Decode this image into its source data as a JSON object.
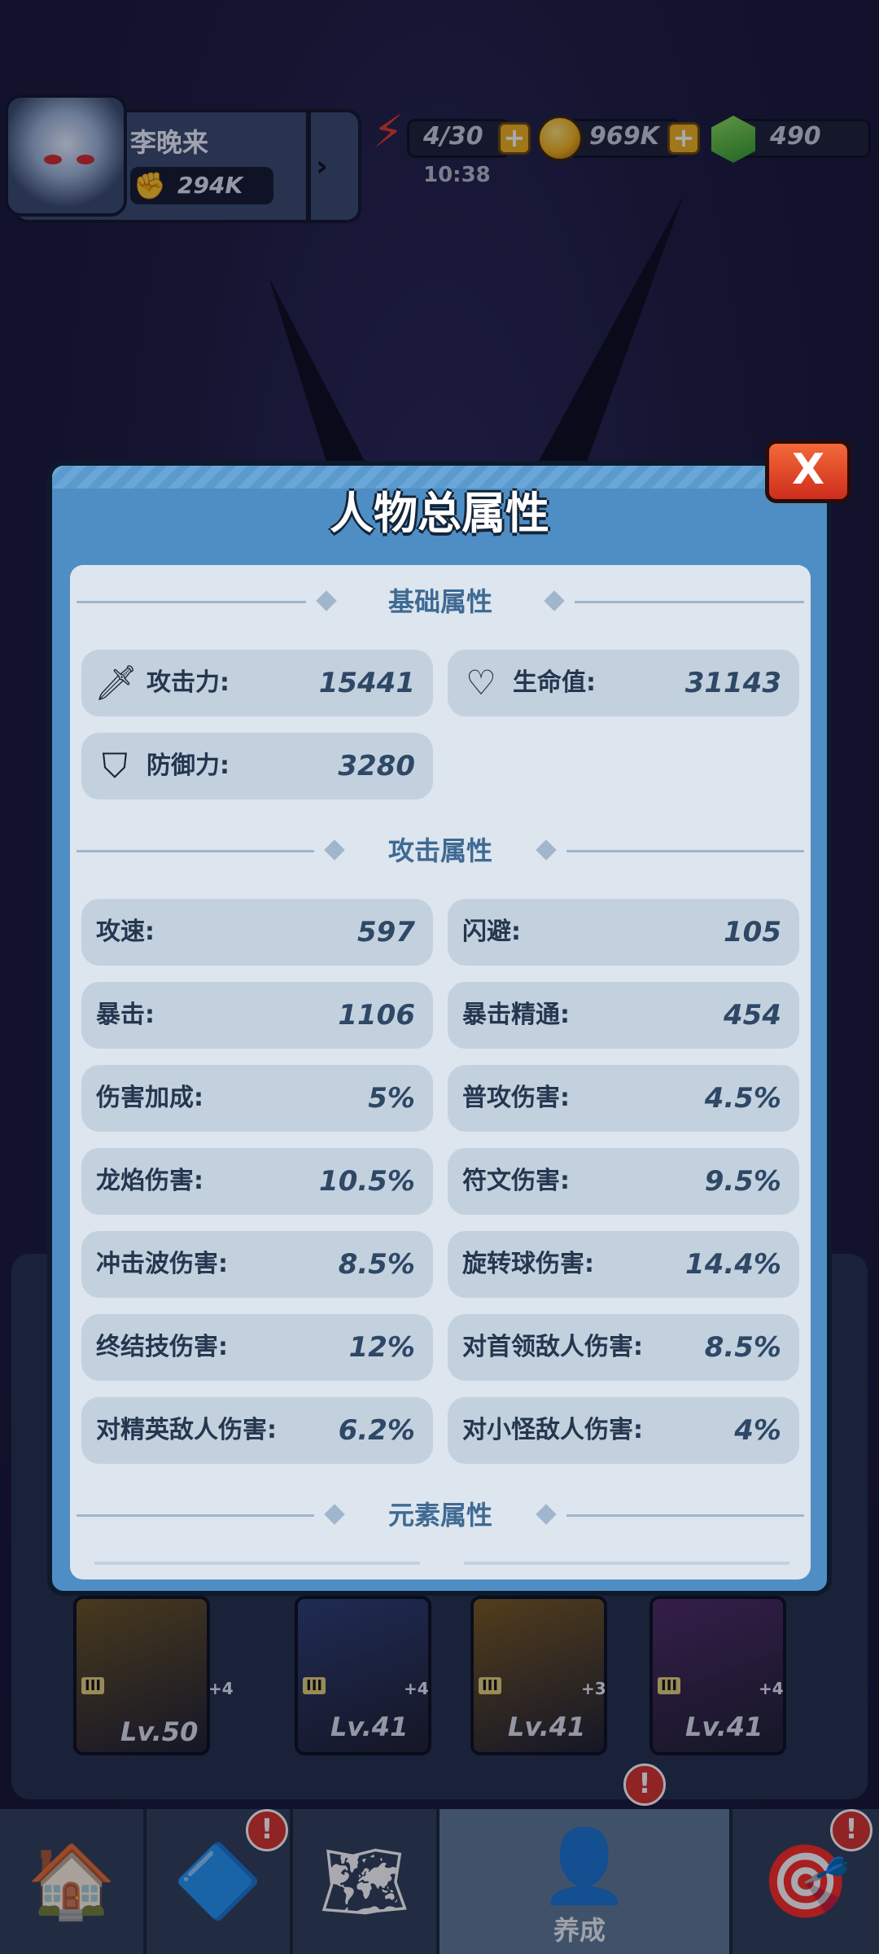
{
  "player": {
    "name": "李晚来",
    "power": "294K"
  },
  "resources": {
    "energy": "4/30",
    "energy_timer": "10:38",
    "gold": "969K",
    "gems": "490"
  },
  "modal": {
    "title": "人物总属性",
    "close_label": "X"
  },
  "sections": {
    "base": "基础属性",
    "attack": "攻击属性",
    "element": "元素属性"
  },
  "base_stats": [
    {
      "label": "攻击力:",
      "value": "15441",
      "icon": "sword-icon"
    },
    {
      "label": "生命值:",
      "value": "31143",
      "icon": "heart-icon"
    },
    {
      "label": "防御力:",
      "value": "3280",
      "icon": "shield-icon"
    }
  ],
  "attack_stats": [
    {
      "label": "攻速:",
      "value": "597"
    },
    {
      "label": "闪避:",
      "value": "105"
    },
    {
      "label": "暴击:",
      "value": "1106"
    },
    {
      "label": "暴击精通:",
      "value": "454"
    },
    {
      "label": "伤害加成:",
      "value": "5%"
    },
    {
      "label": "普攻伤害:",
      "value": "4.5%"
    },
    {
      "label": "龙焰伤害:",
      "value": "10.5%"
    },
    {
      "label": "符文伤害:",
      "value": "9.5%"
    },
    {
      "label": "冲击波伤害:",
      "value": "8.5%"
    },
    {
      "label": "旋转球伤害:",
      "value": "14.4%"
    },
    {
      "label": "终结技伤害:",
      "value": "12%"
    },
    {
      "label": "对首领敌人伤害:",
      "value": "8.5%"
    },
    {
      "label": "对精英敌人伤害:",
      "value": "6.2%"
    },
    {
      "label": "对小怪敌人伤害:",
      "value": "4%"
    }
  ],
  "equipment": [
    {
      "level": "Lv.50",
      "plus": "+4",
      "tier": "III",
      "color": "#6b5420"
    },
    {
      "level": "Lv.41",
      "plus": "+4",
      "tier": "III",
      "color": "#2d3e73"
    },
    {
      "level": "Lv.41",
      "plus": "+3",
      "tier": "III",
      "color": "#7a5a1e"
    },
    {
      "level": "Lv.41",
      "plus": "+4",
      "tier": "III",
      "color": "#4d2a63"
    }
  ],
  "nav": {
    "active_label": "养成",
    "tabs": [
      "house-icon",
      "rune-icon",
      "map-icon",
      "character-icon",
      "target-icon"
    ]
  },
  "colors": {
    "modal_blue": "#4f8ec4",
    "panel": "#dde5ef",
    "stat_pill": "#c3d1df",
    "section_text": "#3f6a93",
    "alert_red": "#d9322a"
  }
}
